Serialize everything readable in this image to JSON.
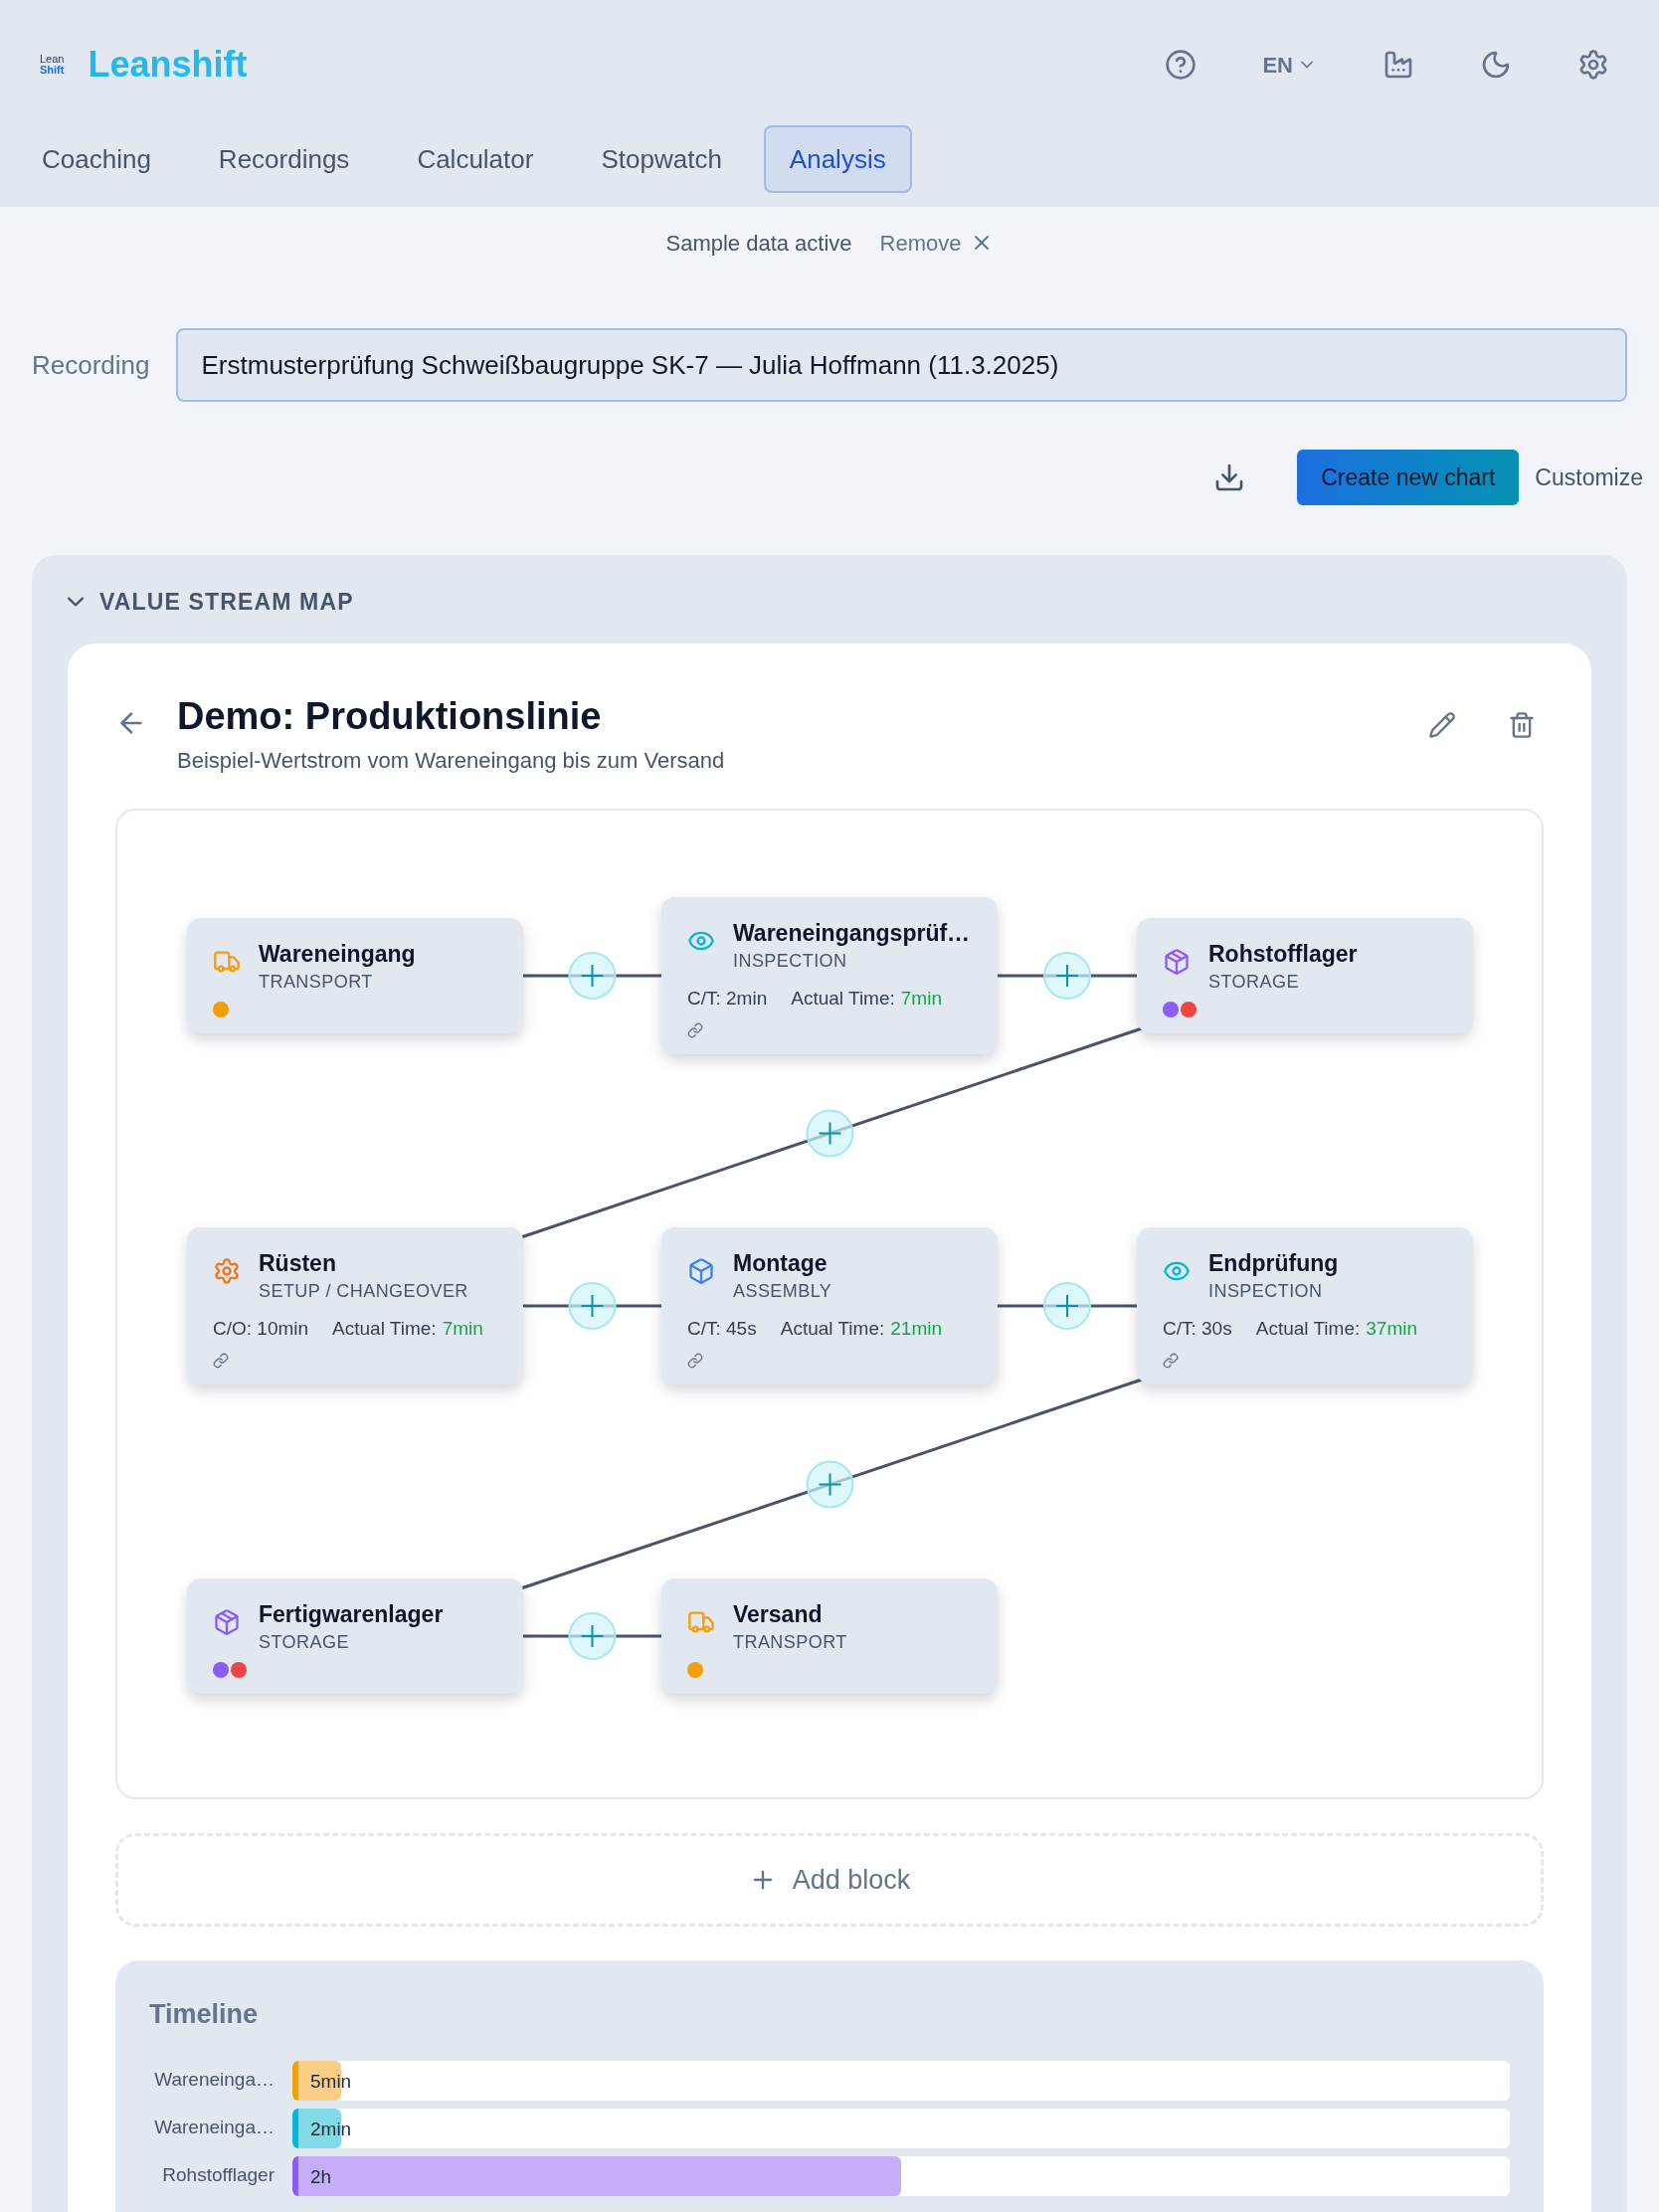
{
  "header": {
    "logo_top": "Lean",
    "logo_bottom": "Shift",
    "brand": "Leanshift",
    "language": "EN"
  },
  "tabs": [
    {
      "label": "Coaching",
      "selected": false
    },
    {
      "label": "Recordings",
      "selected": false
    },
    {
      "label": "Calculator",
      "selected": false
    },
    {
      "label": "Stopwatch",
      "selected": false
    },
    {
      "label": "Analysis",
      "selected": true
    }
  ],
  "banner": {
    "text": "Sample data active",
    "action": "Remove"
  },
  "recording": {
    "label": "Recording",
    "value": "Erstmusterprüfung Schweißbaugruppe SK-7 — Julia Hoffmann (11.3.2025)"
  },
  "toolbar": {
    "primary": "Create new chart",
    "secondary": "Customize"
  },
  "section": {
    "title": "VALUE STREAM MAP",
    "expanded": true
  },
  "map": {
    "title": "Demo: Produktionslinie",
    "subtitle": "Beispiel-Wertstrom vom Wareneingang bis zum Versand",
    "nodes": [
      {
        "kind": "transport",
        "name": "Wareneingang",
        "type": "TRANSPORT",
        "dots": [
          {
            "color": "#f59e0b"
          }
        ]
      },
      {
        "kind": "inspection",
        "name": "Wareneingangsprüf…",
        "type": "INSPECTION",
        "metric": "C/T: 2min",
        "actual_label": "Actual Time:",
        "actual_value": "7min"
      },
      {
        "kind": "storage",
        "name": "Rohstofflager",
        "type": "STORAGE",
        "dots": [
          {
            "color": "#8b5cf6"
          },
          {
            "color": "#ef4444"
          }
        ]
      },
      {
        "kind": "changeover",
        "name": "Rüsten",
        "type": "SETUP / CHANGEOVER",
        "metric": "C/O: 10min",
        "actual_label": "Actual Time:",
        "actual_value": "7min"
      },
      {
        "kind": "assembly",
        "name": "Montage",
        "type": "ASSEMBLY",
        "metric": "C/T: 45s",
        "actual_label": "Actual Time:",
        "actual_value": "21min"
      },
      {
        "kind": "inspection",
        "name": "Endprüfung",
        "type": "INSPECTION",
        "metric": "C/T: 30s",
        "actual_label": "Actual Time:",
        "actual_value": "37min"
      },
      {
        "kind": "storage",
        "name": "Fertigwarenlager",
        "type": "STORAGE",
        "dots": [
          {
            "color": "#8b5cf6"
          },
          {
            "color": "#ef4444"
          }
        ]
      },
      {
        "kind": "transport",
        "name": "Versand",
        "type": "TRANSPORT",
        "dots": [
          {
            "color": "#f59e0b"
          }
        ]
      }
    ],
    "add_block": "Add block"
  },
  "timeline": {
    "title": "Timeline",
    "rows": [
      {
        "label": "Wareneinga…",
        "value": "5min",
        "level": 0.04,
        "color": "#f59e0b"
      },
      {
        "label": "Wareneinga…",
        "value": "2min",
        "level": 0.04,
        "color": "#06b6d4"
      },
      {
        "label": "Rohstofflager",
        "value": "2h",
        "level": 0.5,
        "color": "#8b5cf6"
      }
    ]
  }
}
